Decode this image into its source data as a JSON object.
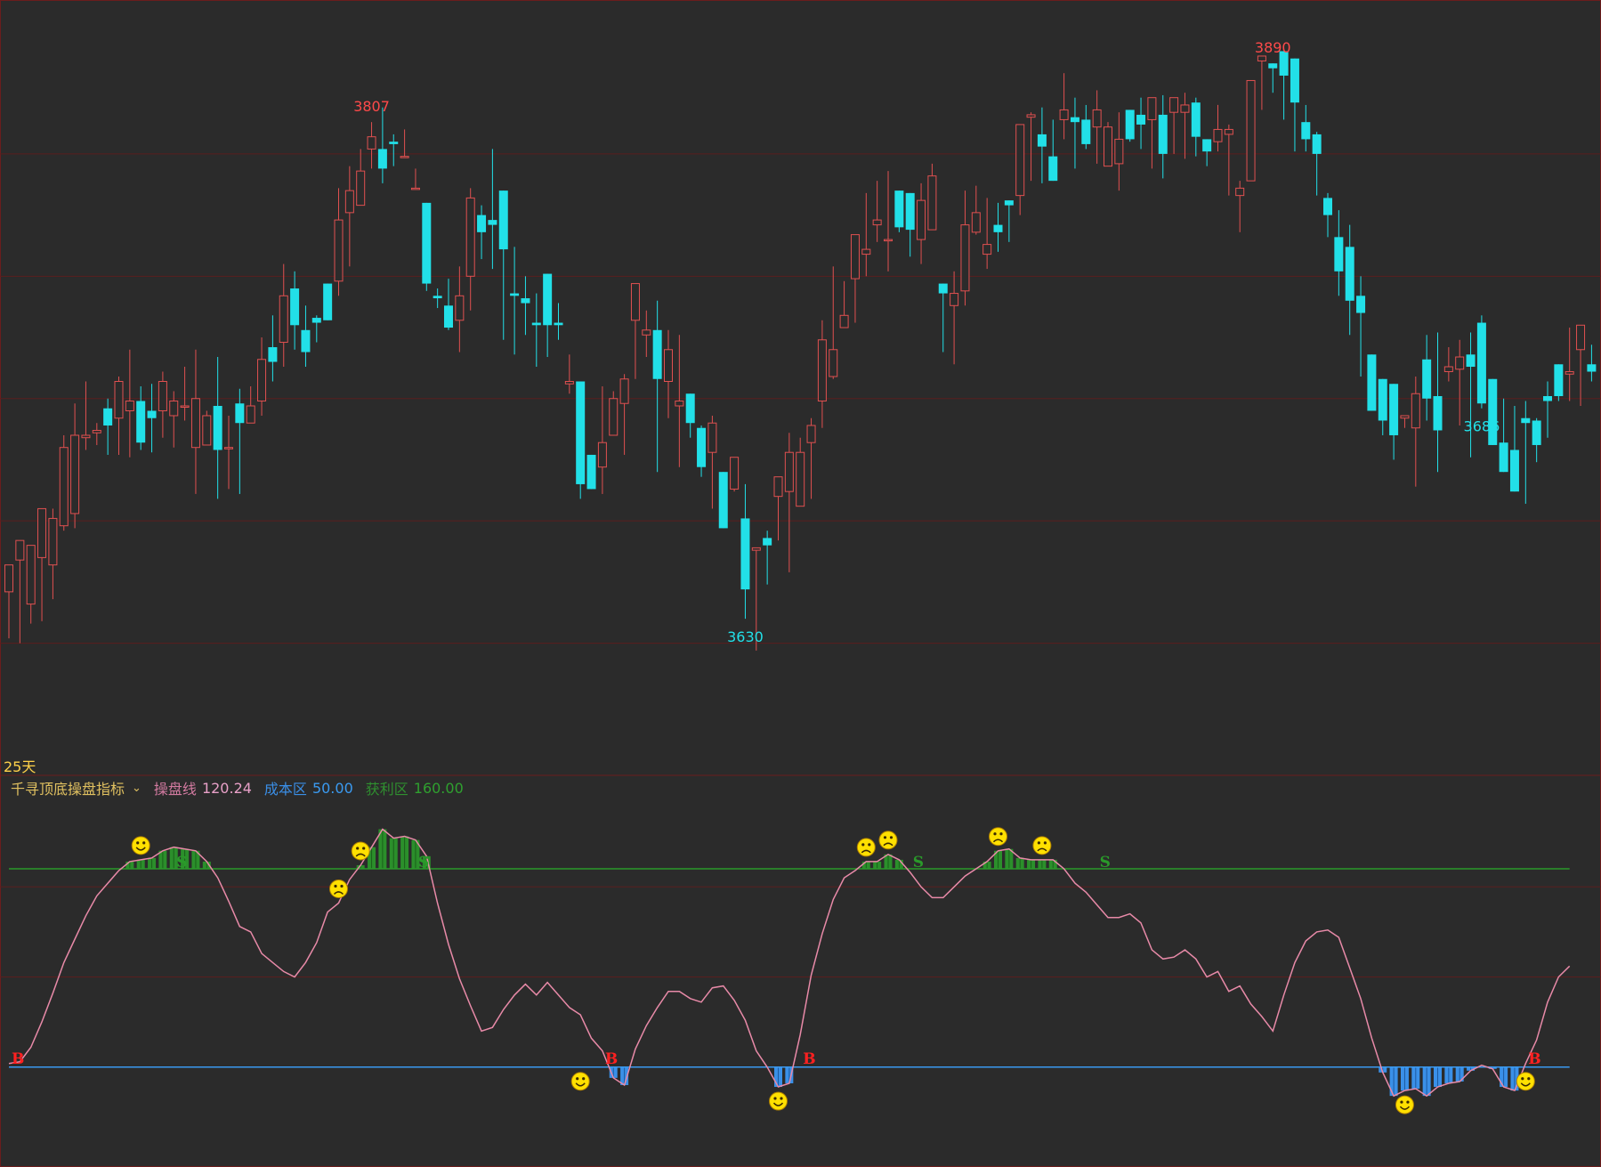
{
  "period_label": "25天",
  "indicator": {
    "name": "千寻顶底操盘指标",
    "items": [
      {
        "label": "操盘线",
        "value": "120.24",
        "label_color": "#d27aa0",
        "value_color": "#e8a0c8"
      },
      {
        "label": "成本区",
        "value": "50.00",
        "label_color": "#3a8ee6",
        "value_color": "#3a9af0"
      },
      {
        "label": "获利区",
        "value": "160.00",
        "label_color": "#2f8f2f",
        "value_color": "#2fa02f"
      }
    ]
  },
  "colors": {
    "background": "#2b2b2b",
    "up": "#e05050",
    "down": "#22e0e8",
    "grid": "#5a1e1e",
    "line": "#e88aa8",
    "cost_line": "#3a9af0",
    "profit_line": "#2a9a2a",
    "profit_fill": "#2b8f2b",
    "cost_fill": "#3a90e8",
    "smiley": "#ffe000",
    "signal_b": "#ff2020",
    "signal_s": "#2a9a2a"
  },
  "chart_data": [
    {
      "type": "candlestick",
      "title": "",
      "annotations": [
        {
          "label": "3807",
          "bar": 33,
          "kind": "high"
        },
        {
          "label": "3630",
          "bar": 67,
          "kind": "low"
        },
        {
          "label": "3890",
          "bar": 115,
          "kind": "high"
        },
        {
          "label": "3686",
          "bar": 134,
          "kind": "low"
        }
      ],
      "ylim": [
        3600,
        3910
      ],
      "candles": [
        [
          3671,
          3682,
          3660,
          3652
        ],
        [
          3684,
          3692,
          3662,
          3650
        ],
        [
          3666,
          3690,
          3690,
          3658
        ],
        [
          3685,
          3705,
          3680,
          3659
        ],
        [
          3682,
          3701,
          3705,
          3668
        ],
        [
          3698,
          3730,
          3735,
          3696
        ],
        [
          3703,
          3735,
          3748,
          3697
        ],
        [
          3734,
          3735,
          3757,
          3729
        ],
        [
          3736,
          3737,
          3740,
          3731
        ],
        [
          3746,
          3739,
          3750,
          3727
        ],
        [
          3742,
          3757,
          3759,
          3727
        ],
        [
          3745,
          3749,
          3770,
          3726
        ],
        [
          3749,
          3732,
          3755,
          3729
        ],
        [
          3745,
          3742,
          3756,
          3728
        ],
        [
          3745,
          3757,
          3761,
          3734
        ],
        [
          3743,
          3749,
          3753,
          3730
        ],
        [
          3747,
          3747,
          3763,
          3741
        ],
        [
          3730,
          3750,
          3770,
          3711
        ],
        [
          3731,
          3743,
          3745,
          3731
        ],
        [
          3747,
          3729,
          3767,
          3709
        ],
        [
          3730,
          3730,
          3743,
          3713
        ],
        [
          3748,
          3740,
          3754,
          3711
        ],
        [
          3740,
          3747,
          3755,
          3741
        ],
        [
          3749,
          3766,
          3775,
          3743
        ],
        [
          3771,
          3765,
          3784,
          3757
        ],
        [
          3773,
          3792,
          3805,
          3763
        ],
        [
          3795,
          3780,
          3802,
          3770
        ],
        [
          3778,
          3769,
          3788,
          3763
        ],
        [
          3783,
          3781,
          3784,
          3773
        ],
        [
          3797,
          3782,
          3795,
          3782
        ],
        [
          3798,
          3823,
          3836,
          3792
        ],
        [
          3826,
          3835,
          3845,
          3804
        ],
        [
          3829,
          3843,
          3852,
          3830
        ],
        [
          3852,
          3857,
          3863,
          3844
        ],
        [
          3852,
          3844,
          3869,
          3838
        ],
        [
          3855,
          3854,
          3858,
          3845
        ],
        [
          3849,
          3849,
          3860,
          3851
        ],
        [
          3836,
          3836,
          3844,
          3836
        ],
        [
          3830,
          3797,
          3830,
          3794
        ],
        [
          3792,
          3791,
          3795,
          3787
        ],
        [
          3788,
          3779,
          3799,
          3778
        ],
        [
          3782,
          3792,
          3804,
          3769
        ],
        [
          3800,
          3832,
          3836,
          3786
        ],
        [
          3825,
          3818,
          3829,
          3807
        ],
        [
          3823,
          3821,
          3852,
          3803
        ],
        [
          3835,
          3811,
          3831,
          3774
        ],
        [
          3793,
          3792,
          3812,
          3768
        ],
        [
          3791,
          3789,
          3800,
          3776
        ],
        [
          3781,
          3780,
          3793,
          3763
        ],
        [
          3801,
          3780,
          3792,
          3767
        ],
        [
          3781,
          3780,
          3789,
          3774
        ],
        [
          3756,
          3757,
          3768,
          3752
        ],
        [
          3757,
          3715,
          3755,
          3709
        ],
        [
          3727,
          3713,
          3714,
          3722
        ],
        [
          3722,
          3732,
          3755,
          3711
        ],
        [
          3735,
          3750,
          3753,
          3755
        ],
        [
          3748,
          3758,
          3760,
          3727
        ],
        [
          3782,
          3797,
          3785,
          3758
        ],
        [
          3776,
          3778,
          3786,
          3767
        ],
        [
          3778,
          3758,
          3790,
          3720
        ],
        [
          3757,
          3770,
          3778,
          3742
        ],
        [
          3747,
          3749,
          3776,
          3722
        ],
        [
          3752,
          3740,
          3752,
          3734
        ],
        [
          3738,
          3722,
          3739,
          3718
        ],
        [
          3728,
          3740,
          3743,
          3705
        ],
        [
          3720,
          3697,
          3718,
          3711
        ],
        [
          3713,
          3726,
          3718,
          3712
        ],
        [
          3701,
          3672,
          3715,
          3660
        ],
        [
          3688,
          3689,
          3683,
          3647
        ],
        [
          3693,
          3690,
          3696,
          3674
        ],
        [
          3710,
          3718,
          3688,
          3692
        ],
        [
          3712,
          3728,
          3736,
          3679
        ],
        [
          3706,
          3728,
          3734,
          3722
        ],
        [
          3732,
          3739,
          3742,
          3709
        ],
        [
          3749,
          3774,
          3782,
          3738
        ],
        [
          3759,
          3770,
          3804,
          3758
        ],
        [
          3779,
          3784,
          3798,
          3786
        ],
        [
          3799,
          3817,
          3808,
          3781
        ],
        [
          3809,
          3811,
          3834,
          3800
        ],
        [
          3821,
          3823,
          3839,
          3814
        ],
        [
          3815,
          3815,
          3843,
          3802
        ],
        [
          3835,
          3820,
          3828,
          3818
        ],
        [
          3834,
          3819,
          3833,
          3808
        ],
        [
          3815,
          3831,
          3838,
          3805
        ],
        [
          3819,
          3841,
          3846,
          3819
        ],
        [
          3797,
          3793,
          3790,
          3769
        ],
        [
          3788,
          3793,
          3802,
          3764
        ],
        [
          3794,
          3821,
          3835,
          3788
        ],
        [
          3818,
          3826,
          3837,
          3817
        ],
        [
          3809,
          3813,
          3832,
          3803
        ],
        [
          3821,
          3818,
          3830,
          3810
        ],
        [
          3831,
          3829,
          3827,
          3814
        ],
        [
          3833,
          3862,
          3858,
          3825
        ],
        [
          3865,
          3866,
          3867,
          3839
        ],
        [
          3858,
          3853,
          3869,
          3838
        ],
        [
          3849,
          3839,
          3864,
          3846
        ],
        [
          3864,
          3868,
          3883,
          3856
        ],
        [
          3865,
          3863,
          3873,
          3844
        ],
        [
          3864,
          3854,
          3870,
          3852
        ],
        [
          3861,
          3868,
          3876,
          3846
        ],
        [
          3845,
          3861,
          3863,
          3845
        ],
        [
          3846,
          3856,
          3867,
          3835
        ],
        [
          3868,
          3856,
          3867,
          3855
        ],
        [
          3866,
          3862,
          3873,
          3852
        ],
        [
          3864,
          3873,
          3870,
          3844
        ],
        [
          3866,
          3850,
          3874,
          3840
        ],
        [
          3867,
          3873,
          3867,
          3850
        ],
        [
          3867,
          3870,
          3875,
          3848
        ],
        [
          3871,
          3857,
          3873,
          3849
        ],
        [
          3856,
          3851,
          3856,
          3845
        ],
        [
          3855,
          3860,
          3870,
          3851
        ],
        [
          3858,
          3860,
          3862,
          3833
        ],
        [
          3833,
          3836,
          3839,
          3818
        ],
        [
          3839,
          3880,
          3876,
          3857
        ],
        [
          3888,
          3890,
          3884,
          3868
        ],
        [
          3887,
          3885,
          3879,
          3875
        ],
        [
          3892,
          3882,
          3883,
          3864
        ],
        [
          3889,
          3871,
          3885,
          3851
        ],
        [
          3863,
          3856,
          3870,
          3851
        ],
        [
          3858,
          3850,
          3859,
          3833
        ],
        [
          3832,
          3825,
          3834,
          3816
        ],
        [
          3816,
          3802,
          3827,
          3792
        ],
        [
          3812,
          3790,
          3821,
          3776
        ],
        [
          3792,
          3785,
          3800,
          3759
        ],
        [
          3768,
          3745,
          3766,
          3748
        ],
        [
          3758,
          3741,
          3757,
          3735
        ],
        [
          3756,
          3735,
          3756,
          3725
        ],
        [
          3742,
          3743,
          3736,
          3738
        ],
        [
          3738,
          3752,
          3759,
          3714
        ],
        [
          3766,
          3750,
          3776,
          3741
        ],
        [
          3751,
          3737,
          3777,
          3720
        ],
        [
          3761,
          3763,
          3771,
          3757
        ],
        [
          3762,
          3767,
          3774,
          3739
        ],
        [
          3768,
          3763,
          3777,
          3726
        ],
        [
          3781,
          3748,
          3784,
          3746
        ],
        [
          3758,
          3731,
          3754,
          3732
        ],
        [
          3732,
          3720,
          3750,
          3729
        ],
        [
          3729,
          3712,
          3747,
          3724
        ],
        [
          3742,
          3740,
          3749,
          3707
        ],
        [
          3741,
          3731,
          3742,
          3724
        ],
        [
          3751,
          3749,
          3757,
          3734
        ],
        [
          3764,
          3751,
          3759,
          3749
        ],
        [
          3760,
          3761,
          3779,
          3749
        ],
        [
          3770,
          3780,
          3769,
          3747
        ],
        [
          3764,
          3761,
          3772,
          3757
        ]
      ]
    },
    {
      "type": "line",
      "title": "",
      "ylim": [
        0,
        200
      ],
      "levels": {
        "cost": 50,
        "profit": 160
      },
      "series": [
        {
          "name": "操盘线",
          "values": [
            52,
            53,
            61,
            75,
            91,
            108,
            121,
            134,
            145,
            152,
            159,
            164,
            165,
            166,
            170,
            172,
            171,
            170,
            164,
            155,
            142,
            128,
            125,
            113,
            108,
            103,
            100,
            108,
            119,
            136,
            141,
            154,
            162,
            172,
            182,
            177,
            178,
            176,
            167,
            141,
            118,
            99,
            84,
            70,
            72,
            82,
            90,
            96,
            90,
            97,
            90,
            83,
            79,
            66,
            59,
            44,
            40,
            60,
            73,
            83,
            92,
            92,
            88,
            86,
            94,
            95,
            87,
            76,
            59,
            50,
            39,
            41,
            68,
            101,
            124,
            143,
            155,
            159,
            164,
            164,
            168,
            165,
            158,
            150,
            144,
            144,
            150,
            156,
            160,
            164,
            170,
            171,
            166,
            165,
            165,
            165,
            160,
            152,
            147,
            140,
            133,
            133,
            135,
            130,
            115,
            110,
            111,
            115,
            110,
            100,
            103,
            92,
            95,
            85,
            78,
            70,
            90,
            108,
            120,
            125,
            126,
            122,
            105,
            88,
            66,
            47,
            34,
            37,
            38,
            34,
            39,
            41,
            42,
            48,
            51,
            49,
            39,
            37,
            52,
            65,
            86,
            100,
            106
          ]
        }
      ],
      "top_markers": [
        {
          "bar": 12,
          "face": "happy"
        },
        {
          "bar": 30,
          "face": "sad"
        },
        {
          "bar": 32,
          "face": "sad"
        },
        {
          "bar": 78,
          "face": "sad"
        },
        {
          "bar": 80,
          "face": "sad"
        },
        {
          "bar": 90,
          "face": "sad"
        },
        {
          "bar": 94,
          "face": "sad"
        }
      ],
      "bottom_markers": [
        {
          "bar": 52,
          "face": "happy"
        },
        {
          "bar": 70,
          "face": "happy"
        },
        {
          "bar": 127,
          "face": "happy"
        },
        {
          "bar": 138,
          "face": "happy"
        }
      ],
      "signals": [
        {
          "label": "B",
          "bar": 0
        },
        {
          "label": "S",
          "bar": 15
        },
        {
          "label": "S",
          "bar": 37
        },
        {
          "label": "B",
          "bar": 54
        },
        {
          "label": "B",
          "bar": 72
        },
        {
          "label": "S",
          "bar": 82
        },
        {
          "label": "S",
          "bar": 99
        },
        {
          "label": "B",
          "bar": 138
        }
      ]
    }
  ]
}
